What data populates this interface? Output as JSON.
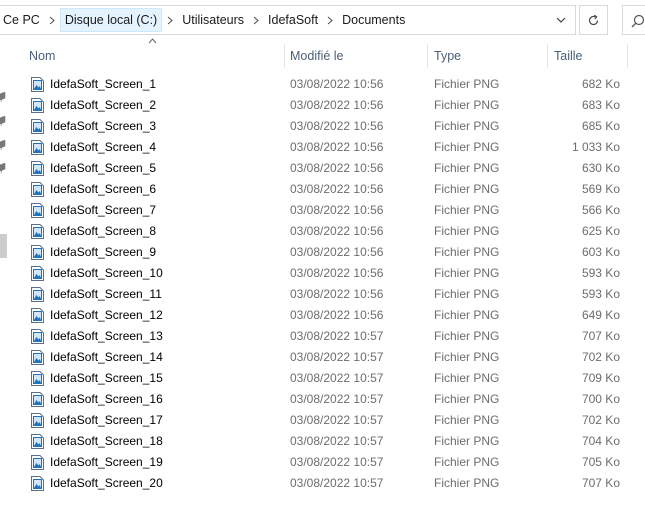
{
  "breadcrumb": [
    "Ce PC",
    "Disque local (C:)",
    "Utilisateurs",
    "IdefaSoft",
    "Documents"
  ],
  "columns": {
    "name": "Nom",
    "modified": "Modifié le",
    "type": "Type",
    "size": "Taille"
  },
  "files": [
    {
      "name": "IdefaSoft_Screen_1",
      "date": "03/08/2022 10:56",
      "type": "Fichier PNG",
      "size": "682 Ko"
    },
    {
      "name": "IdefaSoft_Screen_2",
      "date": "03/08/2022 10:56",
      "type": "Fichier PNG",
      "size": "683 Ko"
    },
    {
      "name": "IdefaSoft_Screen_3",
      "date": "03/08/2022 10:56",
      "type": "Fichier PNG",
      "size": "685 Ko"
    },
    {
      "name": "IdefaSoft_Screen_4",
      "date": "03/08/2022 10:56",
      "type": "Fichier PNG",
      "size": "1 033 Ko"
    },
    {
      "name": "IdefaSoft_Screen_5",
      "date": "03/08/2022 10:56",
      "type": "Fichier PNG",
      "size": "630 Ko"
    },
    {
      "name": "IdefaSoft_Screen_6",
      "date": "03/08/2022 10:56",
      "type": "Fichier PNG",
      "size": "569 Ko"
    },
    {
      "name": "IdefaSoft_Screen_7",
      "date": "03/08/2022 10:56",
      "type": "Fichier PNG",
      "size": "566 Ko"
    },
    {
      "name": "IdefaSoft_Screen_8",
      "date": "03/08/2022 10:56",
      "type": "Fichier PNG",
      "size": "625 Ko"
    },
    {
      "name": "IdefaSoft_Screen_9",
      "date": "03/08/2022 10:56",
      "type": "Fichier PNG",
      "size": "603 Ko"
    },
    {
      "name": "IdefaSoft_Screen_10",
      "date": "03/08/2022 10:56",
      "type": "Fichier PNG",
      "size": "593 Ko"
    },
    {
      "name": "IdefaSoft_Screen_11",
      "date": "03/08/2022 10:56",
      "type": "Fichier PNG",
      "size": "593 Ko"
    },
    {
      "name": "IdefaSoft_Screen_12",
      "date": "03/08/2022 10:56",
      "type": "Fichier PNG",
      "size": "649 Ko"
    },
    {
      "name": "IdefaSoft_Screen_13",
      "date": "03/08/2022 10:57",
      "type": "Fichier PNG",
      "size": "707 Ko"
    },
    {
      "name": "IdefaSoft_Screen_14",
      "date": "03/08/2022 10:57",
      "type": "Fichier PNG",
      "size": "702 Ko"
    },
    {
      "name": "IdefaSoft_Screen_15",
      "date": "03/08/2022 10:57",
      "type": "Fichier PNG",
      "size": "709 Ko"
    },
    {
      "name": "IdefaSoft_Screen_16",
      "date": "03/08/2022 10:57",
      "type": "Fichier PNG",
      "size": "700 Ko"
    },
    {
      "name": "IdefaSoft_Screen_17",
      "date": "03/08/2022 10:57",
      "type": "Fichier PNG",
      "size": "702 Ko"
    },
    {
      "name": "IdefaSoft_Screen_18",
      "date": "03/08/2022 10:57",
      "type": "Fichier PNG",
      "size": "704 Ko"
    },
    {
      "name": "IdefaSoft_Screen_19",
      "date": "03/08/2022 10:57",
      "type": "Fichier PNG",
      "size": "705 Ko"
    },
    {
      "name": "IdefaSoft_Screen_20",
      "date": "03/08/2022 10:57",
      "type": "Fichier PNG",
      "size": "707 Ko"
    }
  ],
  "icons": {
    "separator": "chevron-right-icon",
    "dropdown": "chevron-down-icon",
    "refresh": "refresh-icon",
    "search": "search-icon",
    "file": "png-file-icon",
    "sort": "sort-up-icon"
  },
  "colors": {
    "header_text": "#4c607a",
    "meta_text": "#6d6d6d",
    "active_crumb_bg": "#e5f3ff",
    "border": "#d9d9d9",
    "file_icon_blue": "#1e73be"
  }
}
